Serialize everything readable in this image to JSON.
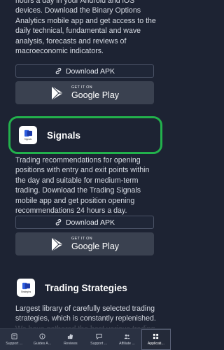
{
  "sections": {
    "intro_text": "hours a day in your Android and iOS devices. Download the Binary Options Analytics mobile app and get access to the daily technical, fundamental and wave analysis, forecasts and reviews of macroeconomic indicators.",
    "download_apk_label": "Download APK",
    "google_play_small": "GET IT ON",
    "google_play_big": "Google Play"
  },
  "signals": {
    "title": "Signals",
    "icon_label": "Signals",
    "description": "Trading recommendations for opening positions with entry and exit points within the day and suitable for medium-term trading. Download the Trading Signals mobile app and get position opening recommendations 24 hours a day.",
    "download_apk_label": "Download APK",
    "google_play_small": "GET IT ON",
    "google_play_big": "Google Play"
  },
  "strategies": {
    "title": "Trading Strategies",
    "icon_label": "Strategies",
    "description": "Largest library of carefully selected trading strategies, which is constantly replenished. We have gathered the best various trading"
  },
  "bottom_nav": {
    "items": [
      {
        "label": "Support ..."
      },
      {
        "label": "Guides A..."
      },
      {
        "label": "Reviews"
      },
      {
        "label": "Support ..."
      },
      {
        "label": "Affiliate ..."
      },
      {
        "label": "Applicati..."
      }
    ],
    "active_index": 5
  },
  "colors": {
    "background": "#1d2333",
    "highlight_border": "#22b14c",
    "google_play_bg": "#3a4150",
    "nav_bg": "#2a3142"
  }
}
